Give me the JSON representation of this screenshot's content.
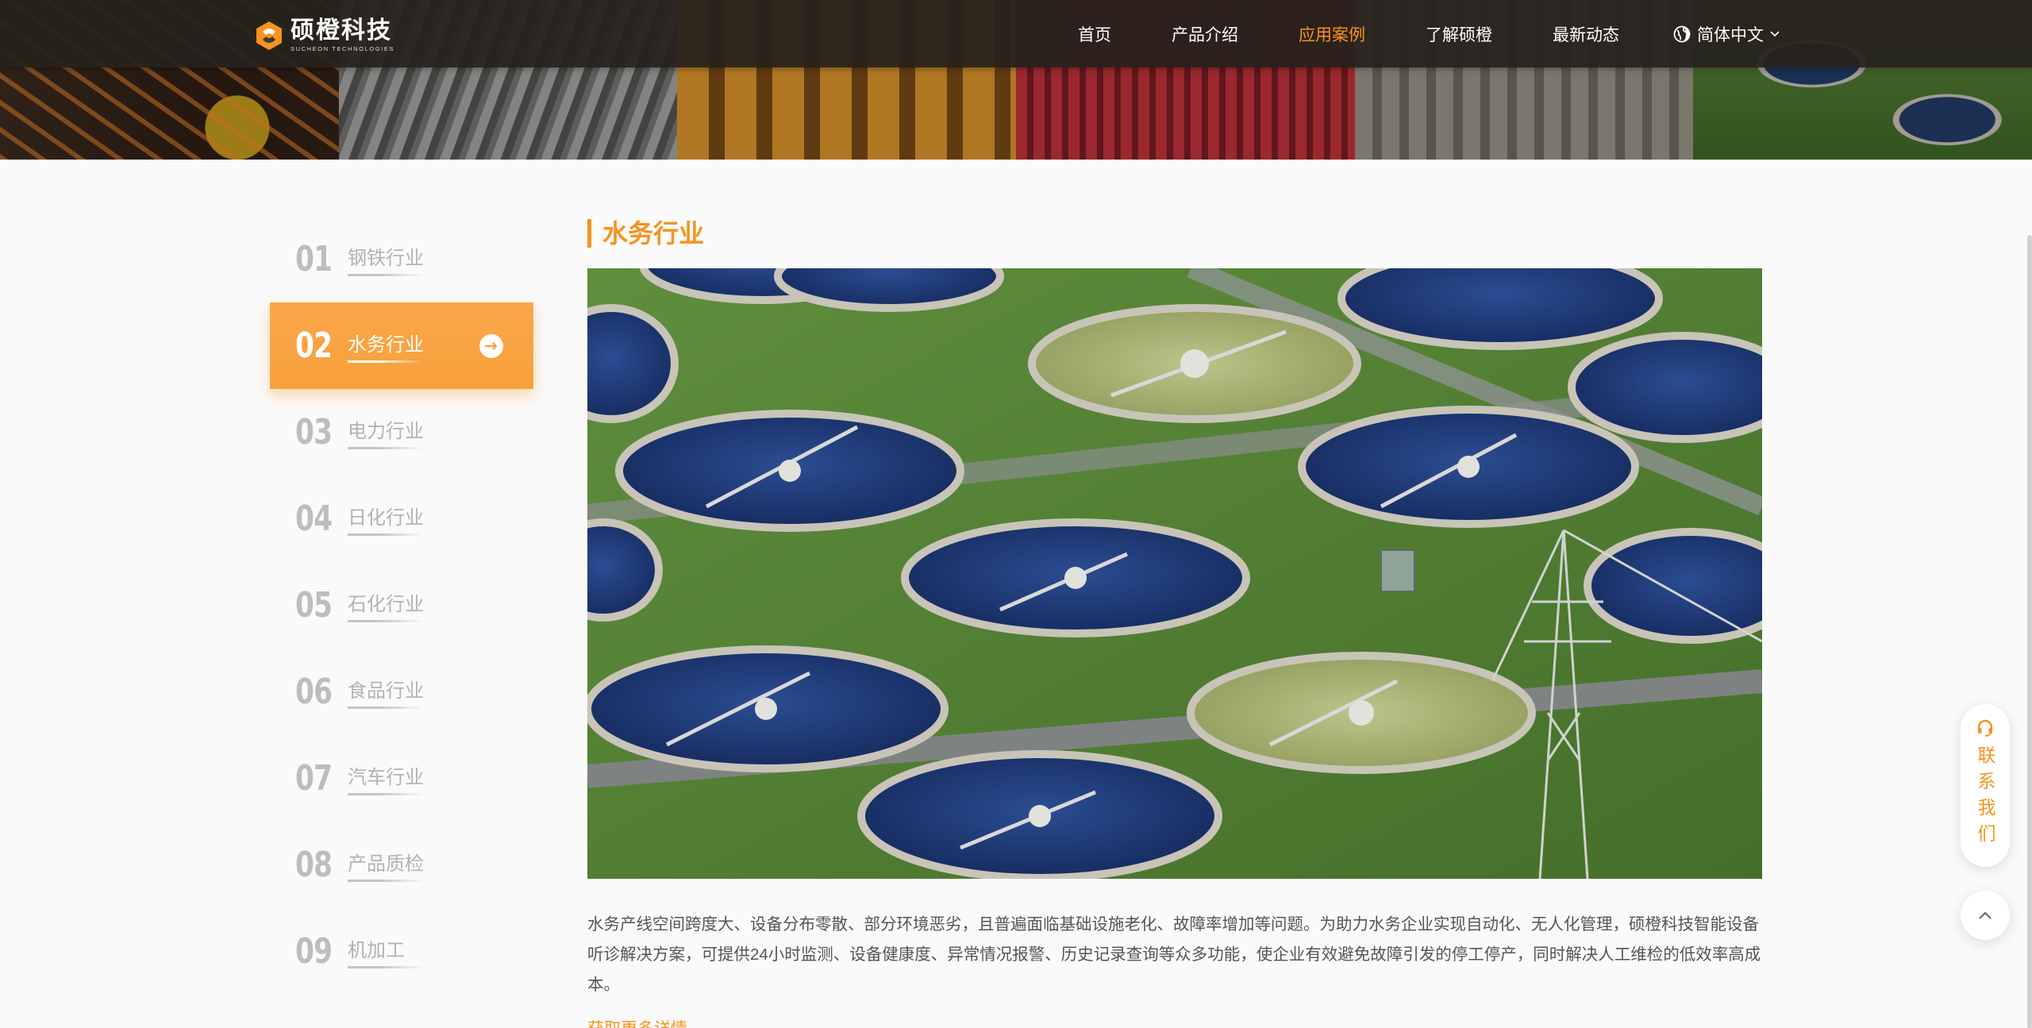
{
  "brand": {
    "name": "硕橙科技",
    "tagline": "SUCHEON TECHNOLOGIES",
    "accent_color": "#f7931e",
    "logo_icon": "sucheon-logo-mark"
  },
  "nav": {
    "items": [
      {
        "label": "首页",
        "active": false
      },
      {
        "label": "产品介绍",
        "active": false
      },
      {
        "label": "应用案例",
        "active": true
      },
      {
        "label": "了解硕橙",
        "active": false
      },
      {
        "label": "最新动态",
        "active": false
      }
    ],
    "language": {
      "label": "简体中文",
      "icon": "globe-icon",
      "caret_icon": "chevron-down-icon"
    }
  },
  "sidebar": {
    "items": [
      {
        "number": "01",
        "label": "钢铁行业",
        "active": false
      },
      {
        "number": "02",
        "label": "水务行业",
        "active": true,
        "icon": "arrow-right-circle-icon"
      },
      {
        "number": "03",
        "label": "电力行业",
        "active": false
      },
      {
        "number": "04",
        "label": "日化行业",
        "active": false
      },
      {
        "number": "05",
        "label": "石化行业",
        "active": false
      },
      {
        "number": "06",
        "label": "食品行业",
        "active": false
      },
      {
        "number": "07",
        "label": "汽车行业",
        "active": false
      },
      {
        "number": "08",
        "label": "产品质检",
        "active": false
      },
      {
        "number": "09",
        "label": "机加工",
        "active": false
      }
    ]
  },
  "content": {
    "title": "水务行业",
    "description": "水务产线空间跨度大、设备分布零散、部分环境恶劣，且普遍面临基础设施老化、故障率增加等问题。为助力水务企业实现自动化、无人化管理，硕橙科技智能设备听诊解决方案，可提供24小时监测、设备健康度、异常情况报警、历史记录查询等众多功能，使企业有效避免故障引发的停工停产，同时解决人工维检的低效率高成本。",
    "more_link": "获取更多详情"
  },
  "widgets": {
    "contact_label": "联系我们",
    "contact_icon": "headset-icon",
    "to_top_icon": "chevron-up-icon"
  }
}
